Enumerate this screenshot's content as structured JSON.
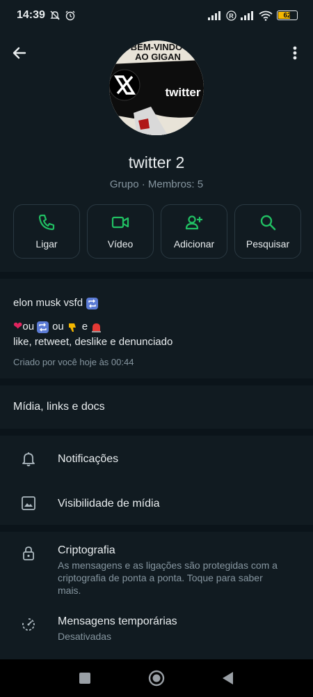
{
  "status_bar": {
    "time": "14:39",
    "battery_level": "62",
    "battery_fraction": 0.62,
    "icons": [
      "mute-icon",
      "alarm-icon",
      "signal-icon",
      "registered-icon",
      "signal-icon",
      "wifi-icon",
      "battery-icon"
    ]
  },
  "header": {
    "back_icon": "arrow-left-icon",
    "menu_icon": "more-vertical-icon"
  },
  "avatar": {
    "banner_line1": "BEM-VINDO",
    "banner_line2": "AO GIGAN",
    "logo_text": "twitter"
  },
  "group": {
    "name": "twitter 2",
    "subtitle": "Grupo · Membros: 5"
  },
  "actions": [
    {
      "label": "Ligar",
      "icon": "phone-icon"
    },
    {
      "label": "Vídeo",
      "icon": "video-icon"
    },
    {
      "label": "Adicionar",
      "icon": "add-person-icon"
    },
    {
      "label": "Pesquisar",
      "icon": "search-icon"
    }
  ],
  "description": {
    "line1": "elon musk vsfd",
    "line2_a": "ou",
    "line2_b": "ou",
    "line2_c": "e",
    "line3": "like, retweet, deslike e denunciado",
    "created": "Criado por você hoje às 00:44"
  },
  "media": {
    "label": "Mídia, links e docs"
  },
  "settings": {
    "notifications": "Notificações",
    "media_visibility": "Visibilidade de mídia",
    "encryption_title": "Criptografia",
    "encryption_sub": "As mensagens e as ligações são protegidas com a criptografia de ponta a ponta. Toque para saber mais.",
    "temp_title": "Mensagens temporárias",
    "temp_sub": "Desativadas"
  },
  "colors": {
    "accent": "#21c063",
    "background": "#0b141a",
    "panel": "#111b21"
  }
}
